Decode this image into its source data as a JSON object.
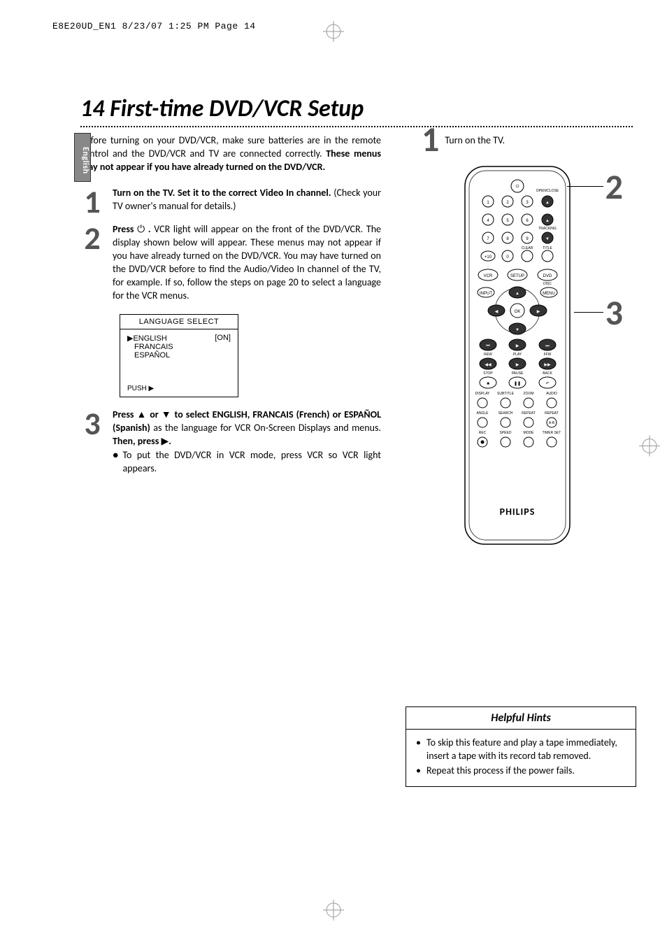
{
  "print_header": "E8E20UD_EN1  8/23/07  1:25 PM  Page 14",
  "lang_tab": "English",
  "title": "14  First-time DVD/VCR Setup",
  "intro": {
    "line1": "Before turning on your DVD/VCR, make sure batteries are in the remote control and the DVD/VCR and TV are connected correctly. ",
    "bold": "These menus may not appear if you have already turned on the DVD/VCR."
  },
  "steps": {
    "s1_num": "1",
    "s1_bold": "Turn on the TV. Set it to the correct Video In channel.",
    "s1_rest": " (Check your TV owner's manual for details.)",
    "s2_num": "2",
    "s2_bold": "Press ",
    "s2_icon": "⏻",
    "s2_bold2": " .",
    "s2_rest": " VCR light will appear on the front of the DVD/VCR. The display shown below will appear. These menus may not appear if you have already turned on the DVD/VCR. You may have turned on the DVD/VCR before to find the Audio/Video In channel of the TV, for example. If so, follow the steps on page 20 to select a language for the VCR menus.",
    "s3_num": "3",
    "s3_a": "Press ",
    "s3_up": "▲",
    "s3_or": " or ",
    "s3_dn": "▼",
    "s3_b": " to select ENGLISH, FRANCAIS (French) or ESPAÑOL (Spanish)",
    "s3_c": " as the language for VCR On-Screen Displays and menus. ",
    "s3_d": "Then, press ",
    "s3_right": "▶",
    "s3_e": ".",
    "s3_bullet": "To put the DVD/VCR in VCR mode, press VCR so VCR light appears."
  },
  "osd": {
    "title": "LANGUAGE SELECT",
    "arrow": "▶",
    "english": "ENGLISH",
    "on": "[ON]",
    "francais": "FRANCAIS",
    "espanol": "ESPAÑOL",
    "footer": "PUSH ▶"
  },
  "right": {
    "num1": "1",
    "text1": "Turn on the TV.",
    "num2": "2",
    "num3": "3",
    "brand": "PHILIPS"
  },
  "remote": {
    "open_close": "OPEN/CLOSE",
    "tracking": "TRACKING",
    "clear": "CLEAR",
    "title": "TITLE",
    "vcr": "VCR",
    "setup": "SETUP",
    "dvd": "DVD",
    "disc": "DISC",
    "menu": "MENU",
    "input": "INPUT",
    "ok": "OK",
    "rew": "REW",
    "play": "PLAY",
    "ffw": "FFW",
    "stop": "STOP",
    "pause": "PAUSE",
    "back": "BACK",
    "display": "DISPLAY",
    "subtitle": "SUBTITLE",
    "zoom": "ZOOM",
    "audio": "AUDIO",
    "angle": "ANGLE",
    "search": "SEARCH",
    "repeat": "REPEAT",
    "repeat_ab": "REPEAT",
    "ab": "A-B",
    "rec": "REC",
    "speed": "SPEED",
    "mode": "MODE",
    "timer_set": "TIMER SET",
    "n1": "1",
    "n2": "2",
    "n3": "3",
    "n4": "4",
    "n5": "5",
    "n6": "6",
    "n7": "7",
    "n8": "8",
    "n9": "9",
    "n0": "0",
    "p10": "+10"
  },
  "hints": {
    "title": "Helpful Hints",
    "h1": "To skip this feature and play a tape immediately, insert a tape with its record tab removed.",
    "h2": "Repeat this process if the power fails."
  }
}
